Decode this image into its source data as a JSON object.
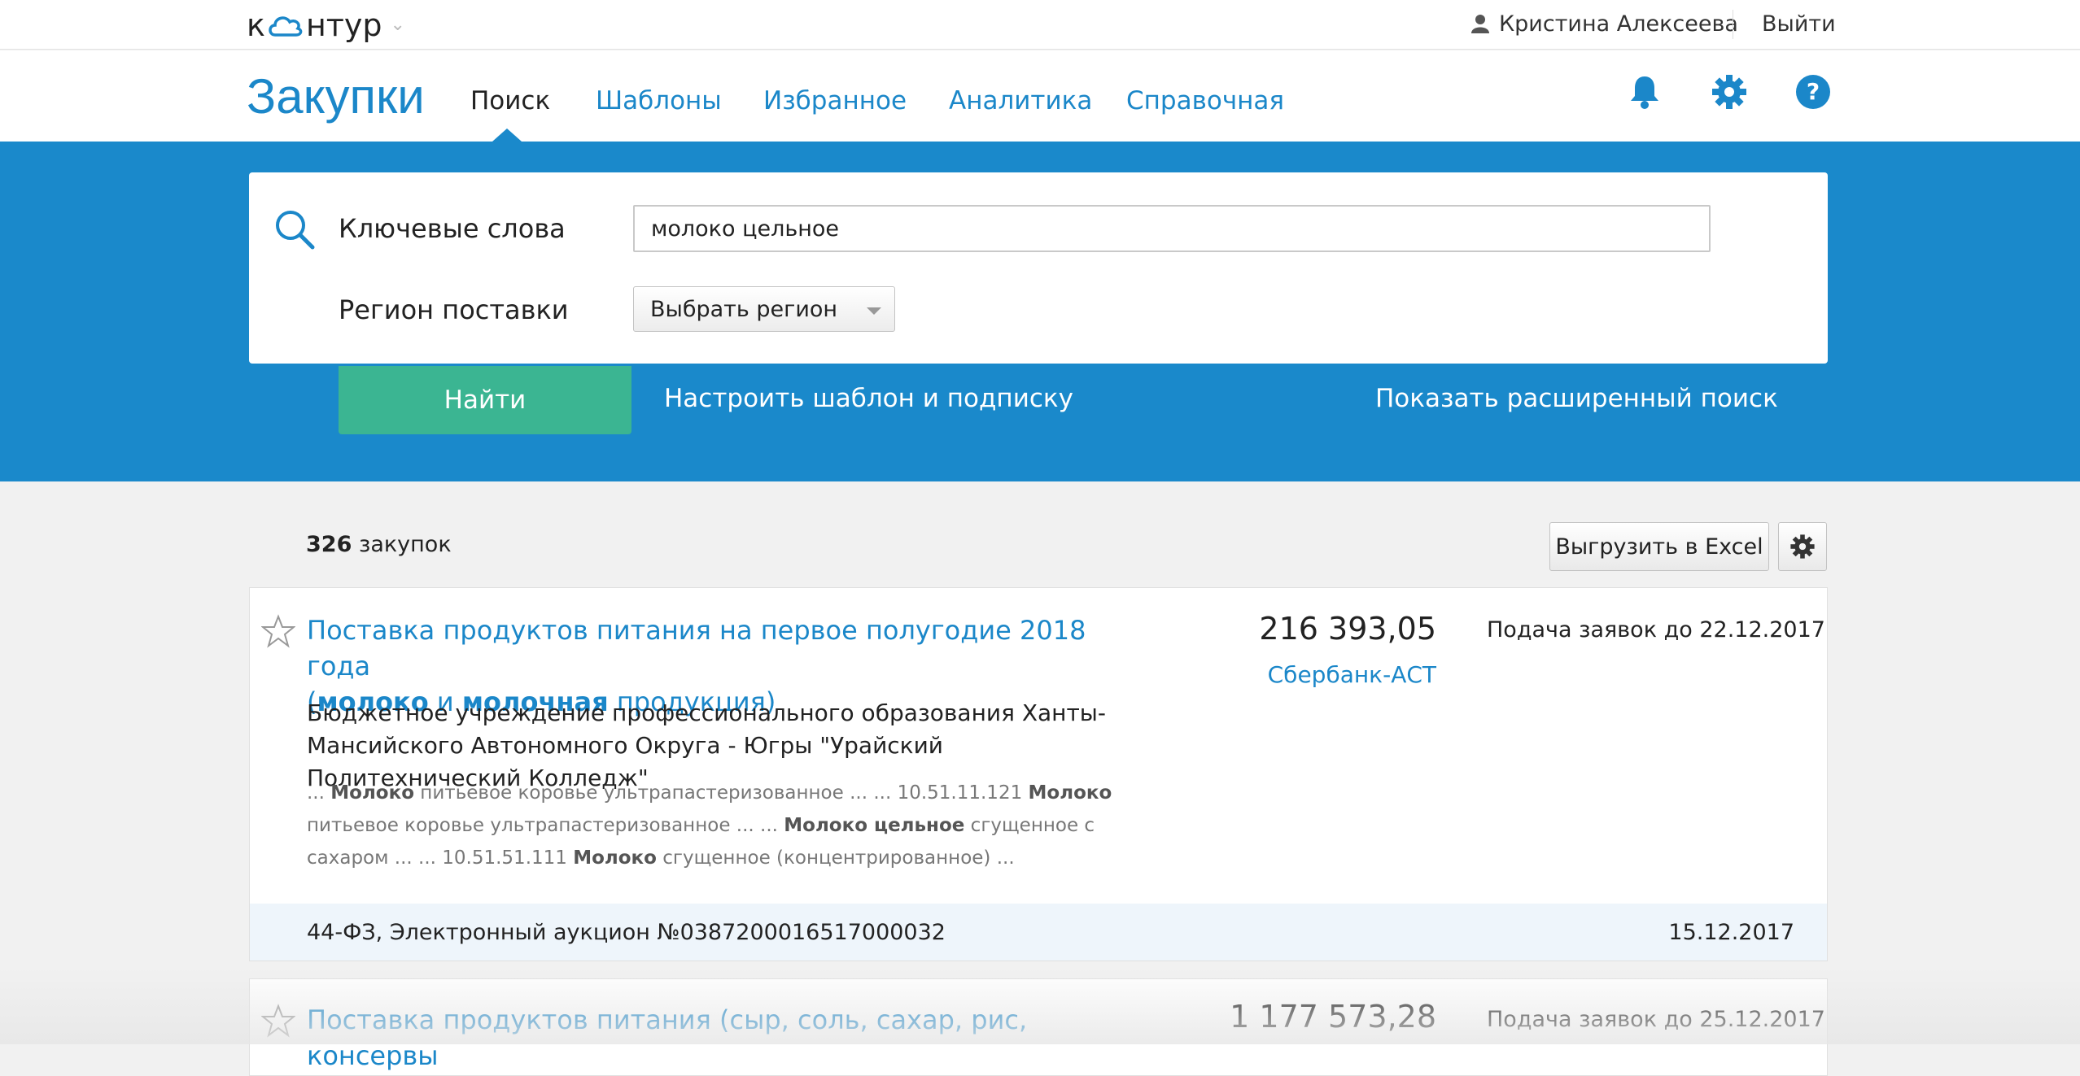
{
  "topbar": {
    "logo_before": "к",
    "logo_after": "нтур",
    "user_name": "Кристина Алексеева",
    "logout": "Выйти"
  },
  "nav": {
    "brand": "Закупки",
    "items": [
      "Поиск",
      "Шаблоны",
      "Избранное",
      "Аналитика",
      "Справочная"
    ],
    "active": "Поиск"
  },
  "search": {
    "keywords_label": "Ключевые слова",
    "keywords_value": "молоко цельное",
    "region_label": "Регион поставки",
    "region_value": "Выбрать регион",
    "find_button": "Найти",
    "template_link": "Настроить шаблон и подписку",
    "advanced_link": "Показать расширенный поиск"
  },
  "results": {
    "count_number": "326",
    "count_suffix": "закупок",
    "excel_button": "Выгрузить в Excel",
    "items": [
      {
        "title_line1": "Поставка продуктов питания на первое полугодие 2018 года",
        "title_open": "(",
        "title_bold1": "молоко",
        "title_mid": " и ",
        "title_bold2": "молочная",
        "title_end": " продукция)",
        "org": "Бюджетное учреждение профессионального образования Ханты-Мансийского Автономного Округа - Югры \"Урайский Политехнический Колледж\"",
        "snippet": [
          {
            "t": "... ",
            "b": false
          },
          {
            "t": "Молоко",
            "b": true
          },
          {
            "t": " питьевое коровье ультрапастеризованное ... ... 10.51.11.121 ",
            "b": false
          },
          {
            "t": "Молоко",
            "b": true
          },
          {
            "t": " питьевое коровье ультрапастеризованное ... ... ",
            "b": false
          },
          {
            "t": "Молоко цельное",
            "b": true
          },
          {
            "t": " сгущенное с сахаром ... ... 10.51.51.111 ",
            "b": false
          },
          {
            "t": "Молоко",
            "b": true
          },
          {
            "t": " сгущенное (концентрированное) ...",
            "b": false
          }
        ],
        "price": "216 393,05",
        "platform": "Сбербанк-АСТ",
        "deadline": "Подача заявок до 22.12.2017",
        "law": "44-ФЗ, Электронный аукцион №0387200016517000032",
        "date": "15.12.2017"
      },
      {
        "title_line1": "Поставка продуктов питания (сыр, соль, сахар, рис, консервы",
        "price": "1 177 573,28",
        "deadline": "Подача заявок до 25.12.2017"
      }
    ]
  },
  "colors": {
    "accent": "#1b87c9",
    "search_bg": "#1a89cb",
    "find_button": "#3bb592"
  },
  "icons": [
    "user-icon",
    "bell-icon",
    "gear-icon",
    "help-icon",
    "search-icon",
    "star-icon",
    "cloud-logo-icon"
  ]
}
